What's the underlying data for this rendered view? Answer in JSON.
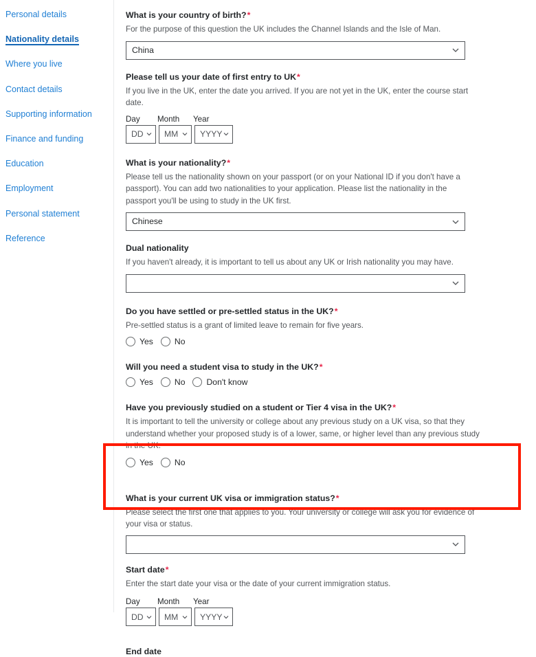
{
  "sidebar": {
    "items": [
      {
        "label": "Personal details",
        "active": false
      },
      {
        "label": "Nationality details",
        "active": true
      },
      {
        "label": "Where you live",
        "active": false
      },
      {
        "label": "Contact details",
        "active": false
      },
      {
        "label": "Supporting information",
        "active": false
      },
      {
        "label": "Finance and funding",
        "active": false
      },
      {
        "label": "Education",
        "active": false
      },
      {
        "label": "Employment",
        "active": false
      },
      {
        "label": "Personal statement",
        "active": false
      },
      {
        "label": "Reference",
        "active": false
      }
    ]
  },
  "colors": {
    "link": "#1f7fd4",
    "active_link": "#1466b5",
    "required_asterisk": "#e8274b",
    "highlight_border": "#ff1a00",
    "field_border": "#53565a",
    "hint_text": "#53565a"
  },
  "form": {
    "country_of_birth": {
      "label": "What is your country of birth?",
      "required": "*",
      "hint": "For the purpose of this question the UK includes the Channel Islands and the Isle of Man.",
      "value": "China",
      "icon": "chevron-down-icon"
    },
    "first_entry_date": {
      "label": "Please tell us your date of first entry to UK",
      "required": "*",
      "hint": "If you live in the UK, enter the date you arrived. If you are not yet in the UK, enter the course start date.",
      "day_head": "Day",
      "month_head": "Month",
      "year_head": "Year",
      "day_value": "DD",
      "month_value": "MM",
      "year_value": "YYYY"
    },
    "nationality": {
      "label": "What is your nationality?",
      "required": "*",
      "hint": "Please tell us the nationality shown on your passport (or on your National ID if you don't have a passport). You can add two nationalities to your application. Please list the nationality in the passport you'll be using to study in the UK first.",
      "value": "Chinese",
      "icon": "chevron-down-icon"
    },
    "dual_nationality": {
      "label": "Dual nationality",
      "required": "",
      "hint": "If you haven't already, it is important to tell us about any UK or Irish nationality you may have.",
      "value": "",
      "icon": "chevron-down-icon"
    },
    "settled_status": {
      "label": "Do you have settled or pre-settled status in the UK?",
      "required": "*",
      "hint": "Pre-settled status is a grant of limited leave to remain for five years.",
      "options": [
        "Yes",
        "No"
      ],
      "selected": ""
    },
    "student_visa": {
      "label": "Will you need a student visa to study in the UK?",
      "required": "*",
      "hint": "",
      "options": [
        "Yes",
        "No",
        "Don't know"
      ],
      "selected": ""
    },
    "previous_study": {
      "label": "Have you previously studied on a student or Tier 4 visa in the UK?",
      "required": "*",
      "hint": "It is important to tell the university or college about any previous study on a UK visa, so that they understand whether your proposed study is of a lower, same, or higher level than any previous study in the UK.",
      "options": [
        "Yes",
        "No"
      ],
      "selected": ""
    },
    "visa_status": {
      "label": "What is your current UK visa or immigration status?",
      "required": "*",
      "hint": "Please select the first one that applies to you. Your university or college will ask you for evidence of your visa or status.",
      "value": "",
      "icon": "chevron-down-icon",
      "highlighted": true
    },
    "start_date": {
      "label": "Start date",
      "required": "*",
      "hint": "Enter the start date your visa or the date of your current immigration status.",
      "day_head": "Day",
      "month_head": "Month",
      "year_head": "Year",
      "day_value": "DD",
      "month_value": "MM",
      "year_value": "YYYY"
    },
    "end_date": {
      "label": "End date",
      "required": ""
    }
  }
}
